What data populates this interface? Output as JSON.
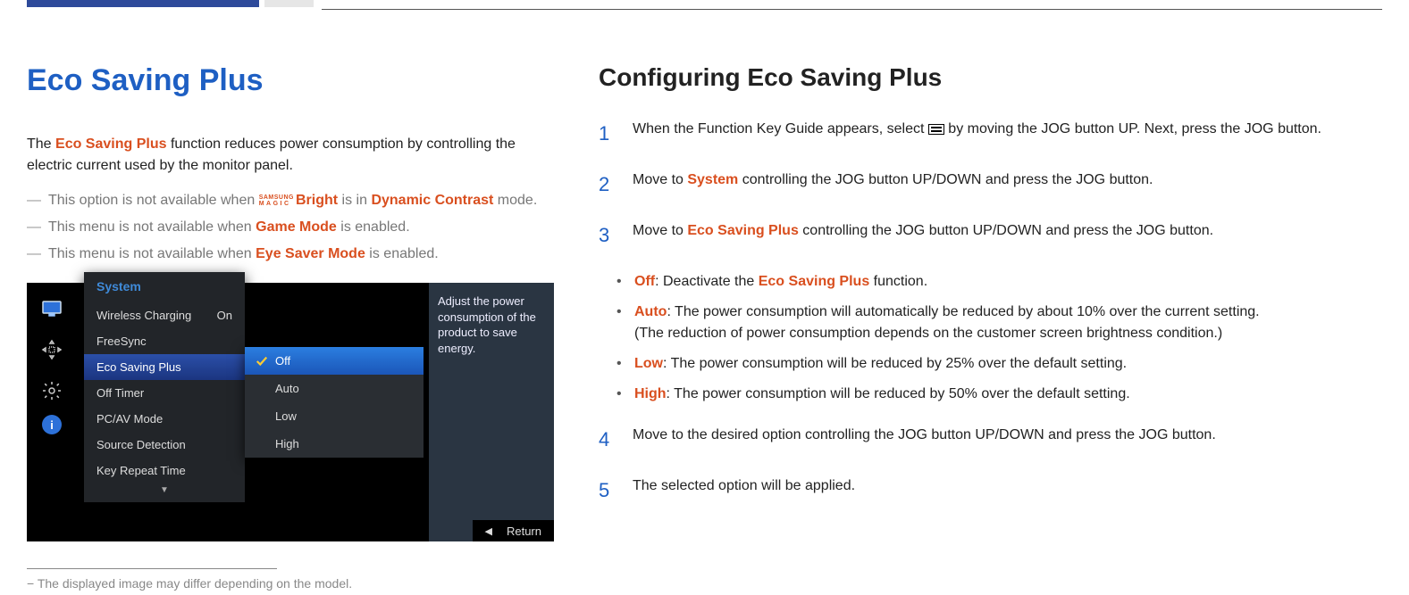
{
  "title_main": "Eco Saving Plus",
  "intro_pre": "The ",
  "intro_emph": "Eco Saving Plus",
  "intro_post": " function reduces power consumption by controlling the electric current used by the monitor panel.",
  "samsung_magic_top": "SAMSUNG",
  "samsung_magic_bottom": "MAGIC",
  "note1_pre": "This option is not available when ",
  "note1_bright": "Bright",
  "note1_mid": " is in ",
  "note1_mode": "Dynamic Contrast",
  "note1_post": " mode.",
  "note2_pre": "This menu is not available when ",
  "note2_emph": "Game Mode",
  "note2_post": " is enabled.",
  "note3_pre": "This menu is not available when ",
  "note3_emph": "Eye Saver Mode",
  "note3_post": " is enabled.",
  "osd": {
    "menu_header": "System",
    "items": [
      {
        "label": "Wireless Charging",
        "value": "On"
      },
      {
        "label": "FreeSync",
        "value": ""
      },
      {
        "label": "Eco Saving Plus",
        "value": ""
      },
      {
        "label": "Off Timer",
        "value": ""
      },
      {
        "label": "PC/AV Mode",
        "value": ""
      },
      {
        "label": "Source Detection",
        "value": ""
      },
      {
        "label": "Key Repeat Time",
        "value": ""
      }
    ],
    "submenu": [
      "Off",
      "Auto",
      "Low",
      "High"
    ],
    "help": "Adjust the power consumption of the product to save energy.",
    "return": "Return"
  },
  "footnote": "The displayed image may differ depending on the model.",
  "title_sub": "Configuring Eco Saving Plus",
  "steps": [
    {
      "num": "1",
      "pre": "When the Function Key Guide appears, select ",
      "icon": true,
      "post": " by moving the JOG button UP. Next, press the JOG button."
    },
    {
      "num": "2",
      "pre": "Move to ",
      "emph": "System",
      "post": " controlling the JOG button UP/DOWN and press the JOG button."
    },
    {
      "num": "3",
      "pre": "Move to ",
      "emph": "Eco Saving Plus",
      "post": " controlling the JOG button UP/DOWN and press the JOG button."
    }
  ],
  "options": [
    {
      "name": "Off",
      "desc": ": Deactivate the ",
      "emph2": "Eco Saving Plus",
      "desc2": " function."
    },
    {
      "name": "Auto",
      "desc": ": The power consumption will automatically be reduced by about 10% over the current setting.",
      "sub": "(The reduction of power consumption depends on the customer screen brightness condition.)"
    },
    {
      "name": "Low",
      "desc": ": The power consumption will be reduced by 25% over the default setting."
    },
    {
      "name": "High",
      "desc": ": The power consumption will be reduced by 50% over the default setting."
    }
  ],
  "steps_after": [
    {
      "num": "4",
      "text": "Move to the desired option controlling the JOG button UP/DOWN and press the JOG button."
    },
    {
      "num": "5",
      "text": "The selected option will be applied."
    }
  ]
}
